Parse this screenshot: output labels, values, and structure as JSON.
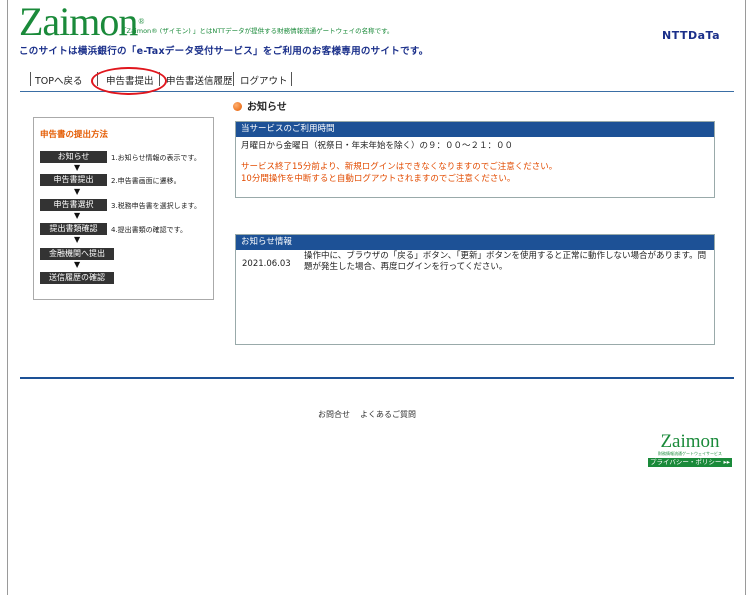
{
  "header": {
    "logo": "Zaimon",
    "logo_mark": "®",
    "tagline_1": "「Zaimon® (ザイモン) 」とはNTTデータが提供する財務情報流通ゲートウェイの名称です。",
    "tagline_2": "このサイトは横浜銀行の「e-Taxデータ受付サービス」をご利用のお客様専用のサイトです。",
    "company": "NTTDaTa"
  },
  "nav": {
    "items": [
      {
        "label": "TOPへ戻る"
      },
      {
        "label": "申告書提出"
      },
      {
        "label": "申告書送信履歴"
      },
      {
        "label": "ログアウト"
      }
    ]
  },
  "notice": {
    "title": "お知らせ"
  },
  "side": {
    "title": "申告書の提出方法",
    "steps": [
      {
        "label": "お知らせ",
        "desc": "1.お知らせ情報の表示です。"
      },
      {
        "label": "申告書提出",
        "desc": "2.申告書画面に遷移。"
      },
      {
        "label": "申告書選択",
        "desc": "3.税務申告書を選択します。"
      },
      {
        "label": "提出書類確認",
        "desc": "4.提出書類の確認です。"
      },
      {
        "label": "金融機関へ提出",
        "desc": ""
      },
      {
        "label": "送信履歴の確認",
        "desc": ""
      }
    ],
    "arrow": "▼"
  },
  "service_hours": {
    "heading": "当サービスのご利用時間",
    "hours": "月曜日から金曜日（祝祭日・年末年始を除く）の９：００～２１：００",
    "warning_1": "サービス終了15分前より、新規ログインはできなくなりますのでご注意ください。",
    "warning_2": "10分間操作を中断すると自動ログアウトされますのでご注意ください。"
  },
  "news": {
    "heading": "お知らせ情報",
    "items": [
      {
        "date": "2021.06.03",
        "text": "操作中に、ブラウザの「戻る」ボタン、「更新」ボタンを使用すると正常に動作しない場合があります。問題が発生した場合、再度ログインを行ってください。"
      }
    ]
  },
  "footer": {
    "contact": "お問合せ",
    "faq": "よくあるご質問",
    "badge_logo": "Zaimon",
    "badge_sub": "財務情報流通ゲートウェイサービス",
    "badge_privacy": "プライバシー・ポリシー ▸▸"
  },
  "colors": {
    "brand_green": "#1a8a3a",
    "brand_navy": "#1a2f8a",
    "header_blue": "#1d5196",
    "warning_orange": "#e24b00",
    "annotation_red": "#e0161d"
  }
}
